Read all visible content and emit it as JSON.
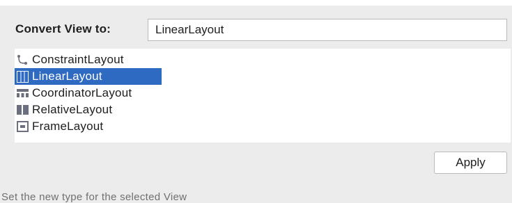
{
  "dialog": {
    "convert_label": "Convert View to:",
    "type_field_value": "LinearLayout",
    "apply_label": "Apply",
    "help_text": "Set the new type for the selected View"
  },
  "layout_list": {
    "selected": "LinearLayout",
    "items": [
      {
        "label": "ConstraintLayout",
        "icon": "constraint-layout-icon"
      },
      {
        "label": "LinearLayout",
        "icon": "linear-layout-icon"
      },
      {
        "label": "CoordinatorLayout",
        "icon": "coordinator-layout-icon"
      },
      {
        "label": "RelativeLayout",
        "icon": "relative-layout-icon"
      },
      {
        "label": "FrameLayout",
        "icon": "frame-layout-icon"
      }
    ]
  },
  "colors": {
    "selection": "#2e69c2",
    "icon_gray": "#6c707e",
    "background": "#ececec"
  }
}
